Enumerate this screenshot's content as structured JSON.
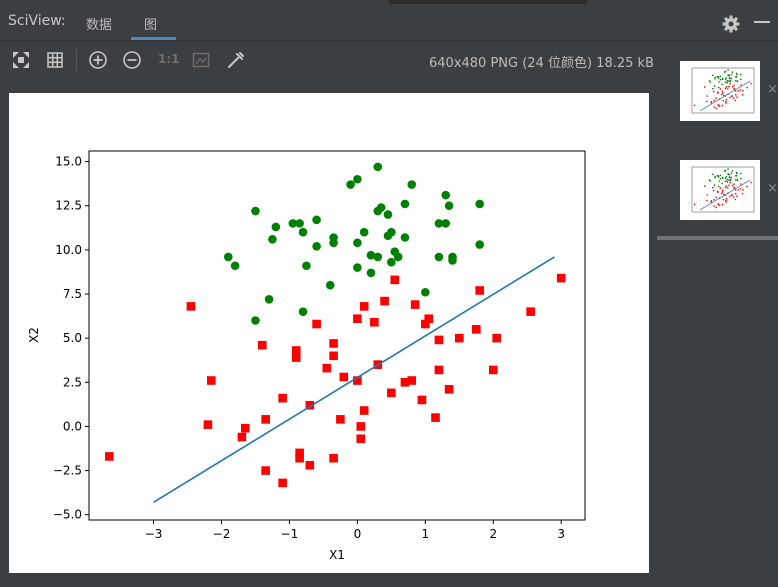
{
  "app": {
    "title": "SciView:",
    "tabs": [
      {
        "label": "数据",
        "active": false
      },
      {
        "label": "图",
        "active": true
      }
    ]
  },
  "toolbar": {
    "icons": [
      "fit-screen-icon",
      "grid-icon",
      "zoom-in-icon",
      "zoom-out-icon",
      "actual-size-icon",
      "background-icon",
      "color-picker-icon"
    ],
    "actual_size_label": "1:1",
    "image_info": "640x480 PNG (24 位颜色) 18.25 kB"
  },
  "thumbnails": [
    {
      "close_label": "×"
    },
    {
      "close_label": "×"
    }
  ],
  "chart_data": {
    "type": "scatter",
    "title": "",
    "xlabel": "X1",
    "ylabel": "X2",
    "xlim": [
      -3.95,
      3.35
    ],
    "ylim": [
      -5.3,
      15.6
    ],
    "xticks": [
      -3,
      -2,
      -1,
      0,
      1,
      2,
      3
    ],
    "yticks": [
      -5.0,
      -2.5,
      0.0,
      2.5,
      5.0,
      7.5,
      10.0,
      12.5,
      15.0
    ],
    "xtick_labels": [
      "−3",
      "−2",
      "−1",
      "0",
      "1",
      "2",
      "3"
    ],
    "ytick_labels": [
      "−5.0",
      "−2.5",
      "0.0",
      "2.5",
      "5.0",
      "7.5",
      "10.0",
      "12.5",
      "15.0"
    ],
    "grid": false,
    "series": [
      {
        "marker": "circle",
        "color": "#008000",
        "points": [
          [
            0.3,
            14.7
          ],
          [
            0.0,
            14.0
          ],
          [
            -0.1,
            13.7
          ],
          [
            0.8,
            13.7
          ],
          [
            1.3,
            13.1
          ],
          [
            1.8,
            12.6
          ],
          [
            -1.5,
            12.2
          ],
          [
            0.3,
            12.2
          ],
          [
            0.35,
            12.4
          ],
          [
            0.45,
            12.0
          ],
          [
            0.7,
            12.6
          ],
          [
            1.35,
            12.5
          ],
          [
            -1.2,
            11.3
          ],
          [
            -0.85,
            11.5
          ],
          [
            -0.95,
            11.5
          ],
          [
            -0.8,
            11.0
          ],
          [
            -0.6,
            11.7
          ],
          [
            0.1,
            11.0
          ],
          [
            0.5,
            11.0
          ],
          [
            0.45,
            10.8
          ],
          [
            1.2,
            11.5
          ],
          [
            1.3,
            11.5
          ],
          [
            -1.25,
            10.6
          ],
          [
            -0.6,
            10.2
          ],
          [
            -0.35,
            10.4
          ],
          [
            -0.35,
            10.7
          ],
          [
            0.0,
            10.4
          ],
          [
            0.7,
            10.7
          ],
          [
            1.8,
            10.3
          ],
          [
            -1.9,
            9.6
          ],
          [
            -1.8,
            9.1
          ],
          [
            -0.75,
            9.1
          ],
          [
            0.0,
            9.0
          ],
          [
            0.2,
            9.7
          ],
          [
            0.3,
            9.6
          ],
          [
            0.5,
            9.3
          ],
          [
            0.55,
            9.9
          ],
          [
            0.6,
            9.6
          ],
          [
            1.2,
            9.6
          ],
          [
            1.4,
            9.4
          ],
          [
            1.4,
            9.6
          ],
          [
            -0.4,
            8.0
          ],
          [
            0.2,
            8.7
          ],
          [
            1.0,
            7.6
          ],
          [
            -1.3,
            7.2
          ],
          [
            -0.8,
            6.5
          ],
          [
            -1.5,
            6.0
          ]
        ]
      },
      {
        "marker": "square",
        "color": "#ff0000",
        "points": [
          [
            0.55,
            8.3
          ],
          [
            3.0,
            8.4
          ],
          [
            1.8,
            7.7
          ],
          [
            -2.45,
            6.8
          ],
          [
            0.4,
            7.1
          ],
          [
            0.1,
            6.8
          ],
          [
            0.85,
            6.9
          ],
          [
            2.55,
            6.5
          ],
          [
            0.0,
            6.1
          ],
          [
            -0.6,
            5.8
          ],
          [
            0.25,
            5.9
          ],
          [
            1.0,
            5.8
          ],
          [
            1.05,
            6.1
          ],
          [
            1.75,
            5.5
          ],
          [
            1.2,
            4.9
          ],
          [
            1.5,
            5.0
          ],
          [
            2.05,
            5.0
          ],
          [
            -1.4,
            4.6
          ],
          [
            -0.9,
            4.3
          ],
          [
            -0.9,
            3.9
          ],
          [
            -0.35,
            4.0
          ],
          [
            -0.35,
            4.7
          ],
          [
            0.3,
            3.5
          ],
          [
            -0.45,
            3.3
          ],
          [
            1.2,
            3.2
          ],
          [
            2.0,
            3.2
          ],
          [
            -2.15,
            2.6
          ],
          [
            -0.2,
            2.8
          ],
          [
            0.0,
            2.6
          ],
          [
            0.7,
            2.5
          ],
          [
            0.8,
            2.6
          ],
          [
            0.5,
            1.9
          ],
          [
            1.35,
            2.1
          ],
          [
            -1.1,
            1.6
          ],
          [
            -0.7,
            1.2
          ],
          [
            0.95,
            1.5
          ],
          [
            0.1,
            0.9
          ],
          [
            -0.25,
            0.4
          ],
          [
            1.15,
            0.5
          ],
          [
            -1.35,
            0.4
          ],
          [
            -2.2,
            0.1
          ],
          [
            0.05,
            0.0
          ],
          [
            0.05,
            -0.7
          ],
          [
            -1.65,
            -0.1
          ],
          [
            -1.7,
            -0.6
          ],
          [
            -3.65,
            -1.7
          ],
          [
            -0.85,
            -1.5
          ],
          [
            -0.85,
            -1.8
          ],
          [
            -0.35,
            -1.8
          ],
          [
            -0.7,
            -2.2
          ],
          [
            -1.35,
            -2.5
          ],
          [
            -1.1,
            -3.2
          ]
        ]
      },
      {
        "marker": "line",
        "color": "#1f77b4",
        "points": [
          [
            -3.0,
            -4.3
          ],
          [
            2.9,
            9.6
          ]
        ]
      }
    ]
  }
}
